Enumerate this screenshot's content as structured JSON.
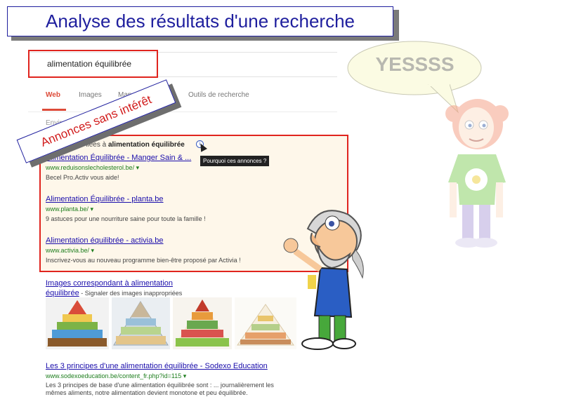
{
  "slide": {
    "title": "Analyse des résultats d'une recherche",
    "annotation": "Annonces sans intérêt",
    "speech": "YESSSS"
  },
  "search": {
    "query": "alimentation équilibrée"
  },
  "tabs": {
    "web": "Web",
    "images": "Images",
    "maps": "Maps",
    "tools": "Outils de recherche"
  },
  "stats": "Environ … (0,…secondes)",
  "ads": {
    "header_prefix": "Annonces liées à",
    "header_query": "alimentation équilibrée",
    "tooltip": "Pourquoi ces annonces ?",
    "items": [
      {
        "title": "Alimentation Équilibrée - Manger Sain & ...",
        "url": "www.reduisonslecholesterol.be/ ▾",
        "desc": "Becel Pro.Activ vous aide!"
      },
      {
        "title": "Alimentation Équilibrée - planta.be",
        "url": "www.planta.be/ ▾",
        "desc": "9 astuces pour une nourriture saine pour toute la famille !"
      },
      {
        "title": "Alimentation équilibrée - activia.be",
        "url": "www.activia.be/ ▾",
        "desc": "Inscrivez-vous au nouveau programme bien-être proposé par Activia !"
      }
    ]
  },
  "images_result": {
    "title_line1": "Images correspondant à alimentation",
    "title_line2": "équilibrée",
    "report": " - Signaler des images inappropriées"
  },
  "organic": {
    "title": "Les 3 principes d'une alimentation équilibrée - Sodexo Education",
    "url": "www.sodexoeducation.be/content_fr.php?id=115 ▾",
    "desc_line1": "Les 3 principes de base d'une alimentation équilibrée sont : ... journalièrement les",
    "desc_line2": "mêmes aliments, notre alimentation devient monotone et peu équilibrée."
  },
  "colors": {
    "title_blue": "#1f1f9e",
    "highlight_red": "#e0241e",
    "link_blue": "#1a0dab",
    "url_green": "#1e7e1e"
  }
}
